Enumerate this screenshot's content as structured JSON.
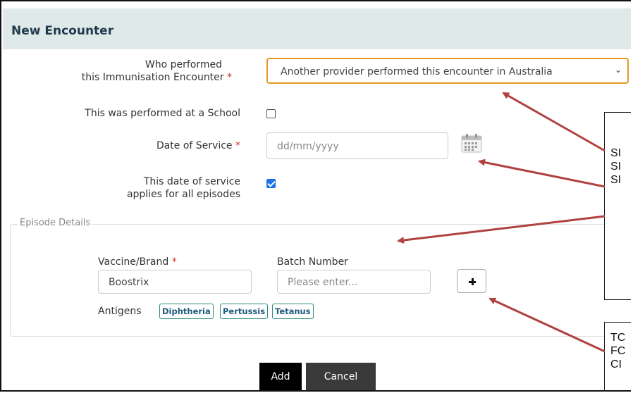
{
  "header": {
    "title": "New Encounter"
  },
  "form": {
    "who_performed_label_line1": "Who performed",
    "who_performed_label_line2": "this Immunisation Encounter",
    "required_marker": "*",
    "who_performed_value": "Another provider performed this encounter in Australia",
    "school_label": "This was performed at a School",
    "school_checked": false,
    "date_label": "Date of Service",
    "date_placeholder": "dd/mm/yyyy",
    "applies_label_line1": "This date of service",
    "applies_label_line2": "applies for all episodes",
    "applies_checked": true
  },
  "episode": {
    "legend": "Episode Details",
    "vaccine_label": "Vaccine/Brand",
    "vaccine_value": "Boostrix",
    "batch_label": "Batch Number",
    "batch_placeholder": "Please enter...",
    "antigens_label": "Antigens",
    "antigens": [
      "Diphtheria",
      "Pertussis",
      "Tetanus"
    ]
  },
  "actions": {
    "add_label": "Add",
    "cancel_label": "Cancel"
  },
  "callouts": {
    "top": [
      "SI",
      "SI",
      "SI"
    ],
    "bottom": [
      "TC",
      "FC",
      "CI"
    ]
  },
  "colors": {
    "accent_border": "#e29b25",
    "required": "#c0392b",
    "arrow": "#b0413e",
    "chip_border": "#2a8c7e"
  },
  "icons": [
    "chevron-down-icon",
    "calendar-icon",
    "plus-icon",
    "checkmark-icon"
  ]
}
